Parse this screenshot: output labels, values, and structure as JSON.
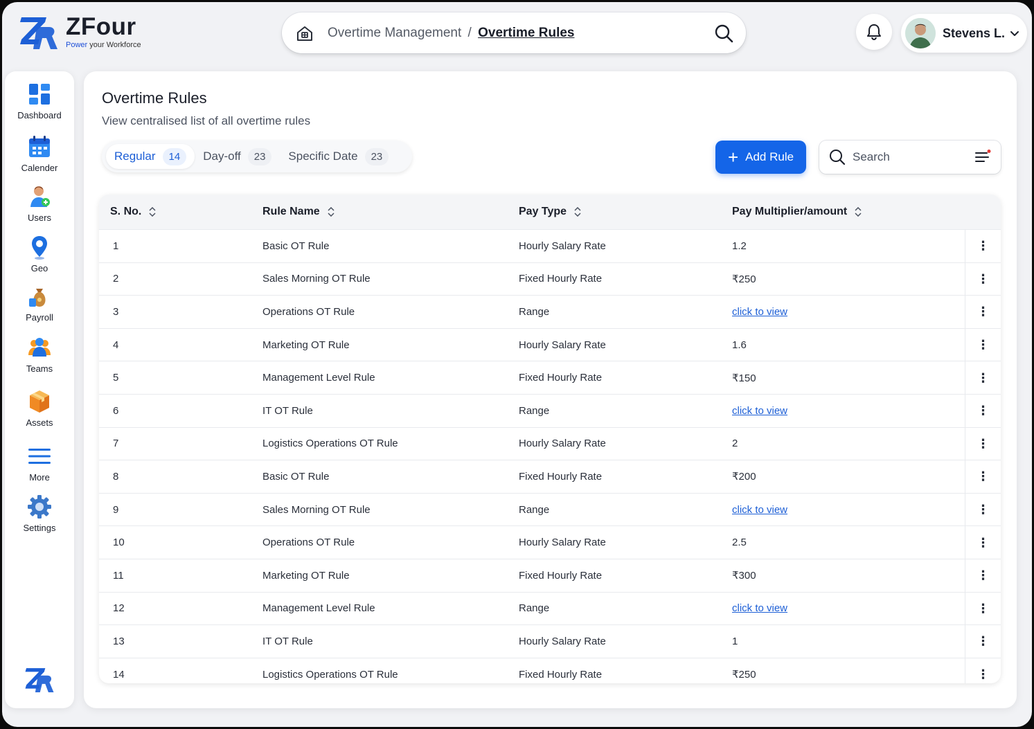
{
  "brand": {
    "name": "ZFour",
    "tagline_a": "Power",
    "tagline_b": "your Workforce"
  },
  "topbar": {
    "breadcrumb_parent": "Overtime Management",
    "breadcrumb_sep": "/",
    "breadcrumb_current": "Overtime Rules",
    "user_name": "Stevens L."
  },
  "sidebar": {
    "items": [
      {
        "label": "Dashboard",
        "icon": "dashboard-icon"
      },
      {
        "label": "Calender",
        "icon": "calendar-icon"
      },
      {
        "label": "Users",
        "icon": "users-icon"
      },
      {
        "label": "Geo",
        "icon": "geo-pin-icon"
      },
      {
        "label": "Payroll",
        "icon": "money-bag-icon"
      },
      {
        "label": "Teams",
        "icon": "teams-icon"
      },
      {
        "label": "Assets",
        "icon": "box-icon"
      },
      {
        "label": "More",
        "icon": "menu-icon"
      },
      {
        "label": "Settings",
        "icon": "gear-icon"
      }
    ]
  },
  "page": {
    "title": "Overtime Rules",
    "subtitle": "View centralised list of all overtime rules"
  },
  "tabs": [
    {
      "label": "Regular",
      "count": "14",
      "active": true
    },
    {
      "label": "Day-off",
      "count": "23",
      "active": false
    },
    {
      "label": "Specific Date",
      "count": "23",
      "active": false
    }
  ],
  "actions": {
    "add_label": "Add Rule",
    "search_placeholder": "Search"
  },
  "table": {
    "headers": [
      "S. No.",
      "Rule Name",
      "Pay Type",
      "Pay Multiplier/amount"
    ],
    "rows": [
      {
        "no": "1",
        "name": "Basic OT Rule",
        "pay_type": "Hourly Salary Rate",
        "amount": "1.2",
        "link": false
      },
      {
        "no": "2",
        "name": "Sales Morning OT Rule",
        "pay_type": "Fixed Hourly Rate",
        "amount": "₹250",
        "link": false
      },
      {
        "no": "3",
        "name": "Operations OT Rule",
        "pay_type": "Range",
        "amount": "click to view",
        "link": true
      },
      {
        "no": "4",
        "name": "Marketing OT Rule",
        "pay_type": "Hourly Salary Rate",
        "amount": "1.6",
        "link": false
      },
      {
        "no": "5",
        "name": "Management Level Rule",
        "pay_type": "Fixed Hourly Rate",
        "amount": "₹150",
        "link": false
      },
      {
        "no": "6",
        "name": "IT OT Rule",
        "pay_type": "Range",
        "amount": "click to view",
        "link": true
      },
      {
        "no": "7",
        "name": "Logistics Operations OT Rule",
        "pay_type": "Hourly Salary Rate",
        "amount": "2",
        "link": false
      },
      {
        "no": "8",
        "name": "Basic OT Rule",
        "pay_type": "Fixed Hourly Rate",
        "amount": "₹200",
        "link": false
      },
      {
        "no": "9",
        "name": "Sales Morning OT Rule",
        "pay_type": "Range",
        "amount": "click to view",
        "link": true
      },
      {
        "no": "10",
        "name": "Operations OT Rule",
        "pay_type": "Hourly Salary Rate",
        "amount": "2.5",
        "link": false
      },
      {
        "no": "11",
        "name": "Marketing OT Rule",
        "pay_type": "Fixed Hourly Rate",
        "amount": "₹300",
        "link": false
      },
      {
        "no": "12",
        "name": "Management Level Rule",
        "pay_type": "Range",
        "amount": "click to view",
        "link": true
      },
      {
        "no": "13",
        "name": "IT OT Rule",
        "pay_type": "Hourly Salary Rate",
        "amount": "1",
        "link": false
      },
      {
        "no": "14",
        "name": "Logistics Operations OT Rule",
        "pay_type": "Fixed Hourly Rate",
        "amount": "₹250",
        "link": false
      }
    ],
    "row_action_icon": "kebab-menu-icon"
  },
  "colors": {
    "accent": "#1465e8",
    "link": "#1d5fd6",
    "notification_dot": "#e53935"
  }
}
